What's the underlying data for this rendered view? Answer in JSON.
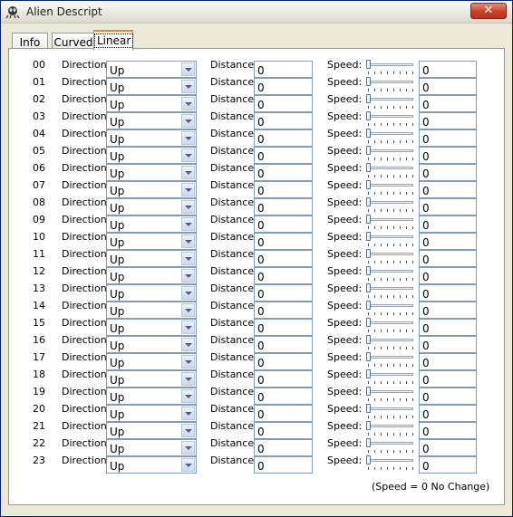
{
  "window": {
    "title": "Alien Descript",
    "close_glyph": "✕"
  },
  "tabs": [
    {
      "label": "Info",
      "active": false
    },
    {
      "label": "Curved",
      "active": false
    },
    {
      "label": "Linear",
      "active": true
    }
  ],
  "labels": {
    "direction": "Direction:",
    "distance": "Distance:",
    "speed": "Speed:"
  },
  "rows": [
    {
      "index": "00",
      "direction": "Up",
      "distance": "0",
      "speed": "0"
    },
    {
      "index": "01",
      "direction": "Up",
      "distance": "0",
      "speed": "0"
    },
    {
      "index": "02",
      "direction": "Up",
      "distance": "0",
      "speed": "0"
    },
    {
      "index": "03",
      "direction": "Up",
      "distance": "0",
      "speed": "0"
    },
    {
      "index": "04",
      "direction": "Up",
      "distance": "0",
      "speed": "0"
    },
    {
      "index": "05",
      "direction": "Up",
      "distance": "0",
      "speed": "0"
    },
    {
      "index": "06",
      "direction": "Up",
      "distance": "0",
      "speed": "0"
    },
    {
      "index": "07",
      "direction": "Up",
      "distance": "0",
      "speed": "0"
    },
    {
      "index": "08",
      "direction": "Up",
      "distance": "0",
      "speed": "0"
    },
    {
      "index": "09",
      "direction": "Up",
      "distance": "0",
      "speed": "0"
    },
    {
      "index": "10",
      "direction": "Up",
      "distance": "0",
      "speed": "0"
    },
    {
      "index": "11",
      "direction": "Up",
      "distance": "0",
      "speed": "0"
    },
    {
      "index": "12",
      "direction": "Up",
      "distance": "0",
      "speed": "0"
    },
    {
      "index": "13",
      "direction": "Up",
      "distance": "0",
      "speed": "0"
    },
    {
      "index": "14",
      "direction": "Up",
      "distance": "0",
      "speed": "0"
    },
    {
      "index": "15",
      "direction": "Up",
      "distance": "0",
      "speed": "0"
    },
    {
      "index": "16",
      "direction": "Up",
      "distance": "0",
      "speed": "0"
    },
    {
      "index": "17",
      "direction": "Up",
      "distance": "0",
      "speed": "0"
    },
    {
      "index": "18",
      "direction": "Up",
      "distance": "0",
      "speed": "0"
    },
    {
      "index": "19",
      "direction": "Up",
      "distance": "0",
      "speed": "0"
    },
    {
      "index": "20",
      "direction": "Up",
      "distance": "0",
      "speed": "0"
    },
    {
      "index": "21",
      "direction": "Up",
      "distance": "0",
      "speed": "0"
    },
    {
      "index": "22",
      "direction": "Up",
      "distance": "0",
      "speed": "0"
    },
    {
      "index": "23",
      "direction": "Up",
      "distance": "0",
      "speed": "0"
    }
  ],
  "speed_slider": {
    "level": 0
  },
  "footnote": "(Speed = 0 No Change)",
  "icons": {
    "app": "alien-icon",
    "close": "close-icon",
    "dropdown": "chevron-down-icon"
  },
  "colors": {
    "active_tab_accent": "#e68b2c",
    "close_button": "#c9432a",
    "field_border": "#7f9db9"
  }
}
